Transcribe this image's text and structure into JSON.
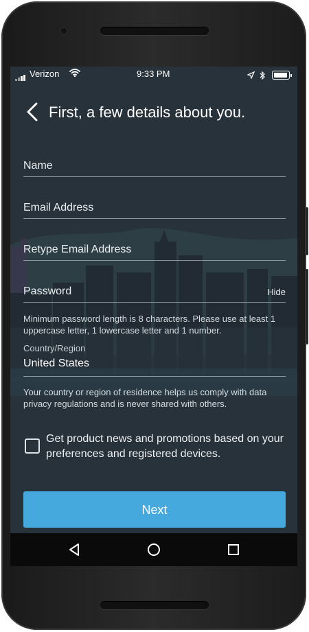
{
  "status_bar": {
    "carrier": "Verizon",
    "time": "9:33 PM"
  },
  "header": {
    "title": "First, a few details about you."
  },
  "form": {
    "name_placeholder": "Name",
    "email_placeholder": "Email Address",
    "retype_email_placeholder": "Retype Email Address",
    "password_placeholder": "Password",
    "hide_label": "Hide",
    "password_hint": "Minimum password length is 8 characters. Please use at least 1 uppercase letter, 1 lowercase letter and 1 number.",
    "country_label": "Country/Region",
    "country_value": "United States",
    "country_hint": "Your country or region of residence helps us comply with data privacy regulations and is never shared with others.",
    "newsletter_label": "Get product news and promotions based on your preferences and registered devices.",
    "newsletter_checked": false
  },
  "actions": {
    "next_label": "Next"
  },
  "colors": {
    "background": "#28323b",
    "accent": "#45a9de",
    "text": "#ffffff"
  },
  "icons": [
    "signal-icon",
    "wifi-icon",
    "location-icon",
    "bluetooth-icon",
    "battery-icon",
    "back-chevron-icon",
    "nav-back-icon",
    "nav-home-icon",
    "nav-recents-icon"
  ]
}
